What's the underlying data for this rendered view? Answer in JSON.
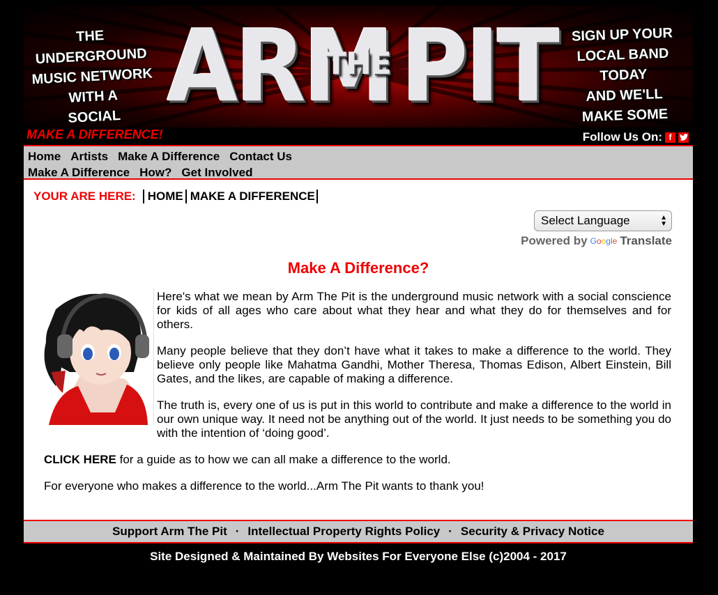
{
  "banner": {
    "tagline_left": "THE UNDERGROUND\nMUSIC NETWORK\nWITH A\nSOCIAL CONSCIENCE",
    "logo_arm": "ARM",
    "logo_the": "THE",
    "logo_pit": "PIT",
    "tagline_right": "SIGN UP YOUR\nLOCAL BAND TODAY\nAND WE'LL\nMAKE SOME NOISE",
    "motto": "MAKE A DIFFERENCE!",
    "follow_label": "Follow Us On:",
    "social": [
      {
        "name": "facebook-icon",
        "glyph": "f"
      },
      {
        "name": "twitter-icon",
        "glyph": "t"
      }
    ]
  },
  "nav": {
    "main": [
      "Home",
      "Artists",
      "Make A Difference",
      "Contact Us"
    ],
    "sub": [
      "Make A Difference",
      "How?",
      "Get Involved"
    ]
  },
  "breadcrumb": {
    "label": "YOUR ARE HERE:",
    "items": [
      "HOME",
      "MAKE A DIFFERENCE"
    ]
  },
  "translate": {
    "select_label": "Select Language",
    "powered_by": "Powered by",
    "google": "Google",
    "translate": "Translate"
  },
  "article": {
    "title": "Make A Difference?",
    "p1": "Here's what we mean by Arm The Pit is the underground music network with a social conscience for kids of all ages who care about what they hear and what they do for themselves and for others.",
    "p2": "Many people believe that they don’t have what it takes to make a difference to the world. They believe only people like Mahatma Gandhi, Mother Theresa, Thomas Edison, Albert Einstein, Bill Gates, and the likes, are capable of making a difference.",
    "p3": "The truth is, every one of us is put in this world to contribute and make a difference to the world in our own unique way. It need not be anything out of the world. It just needs to be something you do with the intention of ‘doing good’.",
    "click_here": "CLICK HERE",
    "p4_rest": " for a guide as to how we can all make a difference to the world.",
    "p5": "For everyone who makes a difference to the world...Arm The Pit wants to thank you!"
  },
  "footer": {
    "links": [
      "Support Arm The Pit",
      "Intellectual Property Rights Policy",
      "Security & Privacy Notice"
    ],
    "separator": "·",
    "credit": "Site Designed & Maintained By  Websites For Everyone Else  (c)2004 - 2017"
  },
  "colors": {
    "accent": "#ee0000",
    "nav_bg": "#c8c8c8",
    "page_bg": "#000000"
  }
}
